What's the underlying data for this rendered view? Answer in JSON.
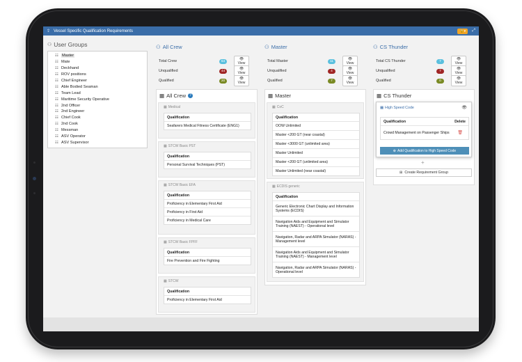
{
  "window": {
    "title": "Vessel Specific Qualification Requirements",
    "lock_label": "🔒▾",
    "expand_icon": "expand-icon"
  },
  "user_groups": {
    "title": "User Groups",
    "items": [
      "Master",
      "Mate",
      "Deckhand",
      "ROV positions",
      "Chief Engineer",
      "Able Bodied Seaman",
      "Team Lead",
      "Maritime Security Operative",
      "2nd Officer",
      "2nd Engineer",
      "Chief Cook",
      "2nd Cook",
      "Messman",
      "ASV Operator",
      "ASV Supervisor"
    ]
  },
  "columns": [
    {
      "heading": "All Crew",
      "stats": [
        {
          "label": "Total Crew",
          "count": "64",
          "button": "View"
        },
        {
          "label": "Unqualified",
          "count": "44",
          "button": "View"
        },
        {
          "label": "Qualified",
          "count": "20",
          "button": "View"
        }
      ],
      "panel_title": "All Crew",
      "help": "?",
      "groups": [
        {
          "name": "Medical",
          "header": "Qualification",
          "rows": [
            "Seafarers Medical Fitness Certificate (ENG1)"
          ]
        },
        {
          "name": "STCW Basic PST",
          "header": "Qualification",
          "rows": [
            "Personal Survival Techniques (PST)"
          ]
        },
        {
          "name": "STCW Basic EFA",
          "header": "Qualification",
          "rows": [
            "Proficiency in Elementary First Aid",
            "Proficiency in First Aid",
            "Proficiency in Medical Care"
          ]
        },
        {
          "name": "STCW Basic FPFF",
          "header": "Qualification",
          "rows": [
            "Fire Prevention and Fire Fighting"
          ]
        },
        {
          "name": "STCW",
          "header": "Qualification",
          "rows": [
            "Proficiency in Elementary First Aid"
          ]
        }
      ]
    },
    {
      "heading": "Master",
      "stats": [
        {
          "label": "Total Master",
          "count": "11",
          "button": "View"
        },
        {
          "label": "Unqualified",
          "count": "4",
          "button": "View"
        },
        {
          "label": "Qualified",
          "count": "7",
          "button": "View"
        }
      ],
      "panel_title": "Master",
      "groups": [
        {
          "name": "CoC",
          "header": "Qualification",
          "rows": [
            "OOW Unlimited",
            "Master <200 GT (near coastal)",
            "Master <3000 GT (unlimited area)",
            "Master Unlimited",
            "Master <200 GT (unlimited area)",
            "Master Unlimited (near coastal)"
          ]
        },
        {
          "name": "ECDIS generic",
          "header": "Qualification",
          "rows": [
            "Generic Electronic Chart Display and Information Systems (ECDIS)",
            "Navigation Aids and Equipment and Simulator Training (NAEST) - Operational level",
            "Navigation, Radar and ARPA Simulator (NARAS) - Management level",
            "Navigation Aids and Equipment and Simulator Training (NAEST) - Management level",
            "Navigation, Radar and ARPA Simulator (NARAS) - Operational level"
          ]
        }
      ]
    },
    {
      "heading": "CS Thunder",
      "stats": [
        {
          "label": "Total CS Thunder",
          "count": "7",
          "button": "View"
        },
        {
          "label": "Unqualified",
          "count": "7",
          "button": "View"
        },
        {
          "label": "Qualified",
          "count": "0",
          "button": "View"
        }
      ],
      "panel_title": "CS Thunder",
      "speed_card": {
        "title": "High Speed Code",
        "col_qualification": "Qualification",
        "col_delete": "Delete",
        "row": "Crowd Management on Passenger Ships",
        "add_button": "Add Qualification to High Speed Code"
      },
      "create_button": "Create Requirement Group"
    }
  ]
}
